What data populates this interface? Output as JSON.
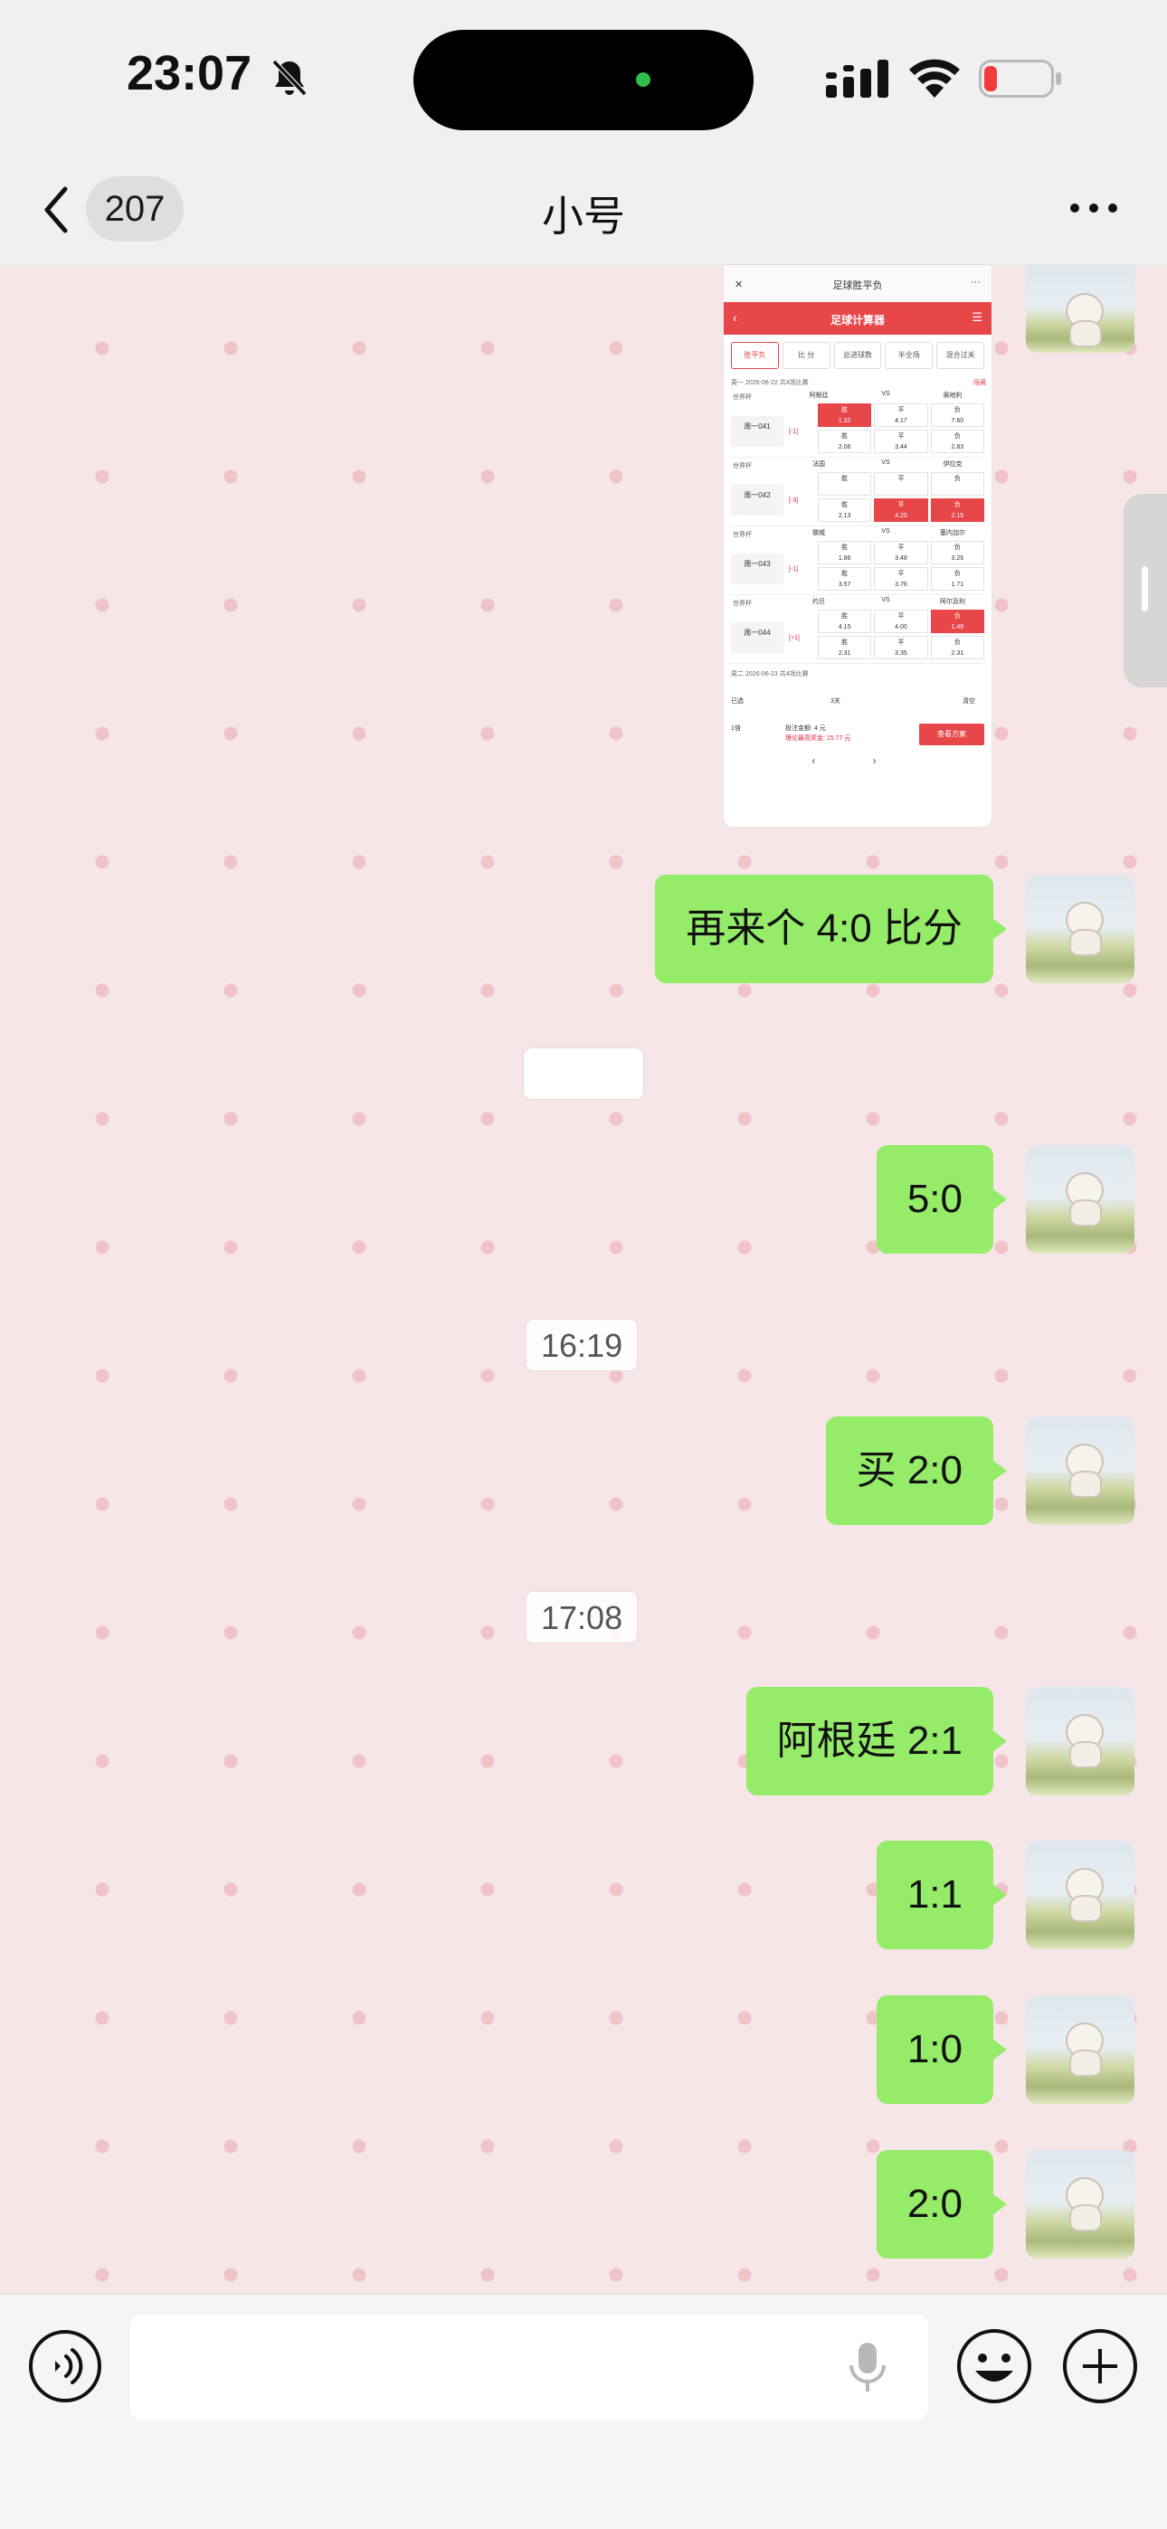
{
  "status": {
    "time": "23:07",
    "icons": [
      "bell-off-icon",
      "signal-icon",
      "wifi-icon",
      "battery-low-icon"
    ],
    "battery_color": "#f23b3b"
  },
  "nav": {
    "back_icon": "chevron-left-icon",
    "unread_count": "207",
    "title": "小号",
    "more_icon": "more-icon"
  },
  "chat": {
    "background": "#f7e6e8",
    "bubble_color": "#95ec69",
    "image_message": {
      "top_title": "足球胜平负",
      "header_title": "足球计算器",
      "tabs": [
        "胜平负",
        "比 分",
        "总进球数",
        "半全场",
        "混合过关"
      ],
      "date_line_1": "周一 2026-06-22 共4场比赛",
      "hide_label": "隐藏",
      "matches": [
        {
          "league": "世界杯",
          "no": "周一041",
          "home": "阿根廷",
          "vs": "VS",
          "away": "奥地利",
          "odds": [
            [
              "胜",
              "1.32"
            ],
            [
              "平",
              "4.17"
            ],
            [
              "负",
              "7.60"
            ],
            [
              "胜",
              "2.06"
            ],
            [
              "平",
              "3.44"
            ],
            [
              "负",
              "2.83"
            ]
          ],
          "on": [
            0
          ],
          "handicap": "[-1]"
        },
        {
          "league": "世界杯",
          "no": "周一042",
          "home": "法国",
          "vs": "VS",
          "away": "伊拉克",
          "odds": [
            [
              "胜",
              ""
            ],
            [
              "平",
              ""
            ],
            [
              "负",
              ""
            ],
            [
              "胜",
              "2.13"
            ],
            [
              "平",
              "4.25"
            ],
            [
              "负",
              "2.15"
            ]
          ],
          "on": [
            4,
            5
          ],
          "handicap": "[-3]"
        },
        {
          "league": "世界杯",
          "no": "周一043",
          "home": "挪威",
          "vs": "VS",
          "away": "塞内加尔",
          "odds": [
            [
              "胜",
              "1.86"
            ],
            [
              "平",
              "3.48"
            ],
            [
              "负",
              "3.26"
            ],
            [
              "胜",
              "3.57"
            ],
            [
              "平",
              "3.76"
            ],
            [
              "负",
              "1.71"
            ]
          ],
          "on": [],
          "handicap": "[-1]"
        },
        {
          "league": "世界杯",
          "no": "周一044",
          "home": "约旦",
          "vs": "VS",
          "away": "阿尔及利",
          "odds": [
            [
              "胜",
              "4.15"
            ],
            [
              "平",
              "4.00"
            ],
            [
              "负",
              "1.49"
            ],
            [
              "胜",
              "2.31"
            ],
            [
              "平",
              "3.35"
            ],
            [
              "负",
              "2.31"
            ]
          ],
          "on": [
            2
          ],
          "handicap": "[+1]"
        }
      ],
      "date_line_2": "周二 2026-06-23 共4场比赛",
      "selected_label": "已选",
      "pass_label": "3关",
      "clear_label": "清空",
      "multiple_label": "1倍",
      "bet_text": "投注金额: 4 元",
      "prize_text": "理论最高奖金: 15.77 元",
      "view_plan_label": "查看方案",
      "pager": "‹ ›"
    },
    "messages": [
      {
        "text": "再来个 4:0 比分"
      },
      {
        "text": "5:0"
      },
      {
        "time": "16:19"
      },
      {
        "text": "买 2:0"
      },
      {
        "time": "17:08"
      },
      {
        "text": "阿根廷 2:1"
      },
      {
        "text": "1:1"
      },
      {
        "text": "1:0"
      },
      {
        "text": "2:0"
      }
    ]
  },
  "input": {
    "value": "",
    "placeholder": "",
    "icons": [
      "voice-icon",
      "mic-icon",
      "emoji-icon",
      "plus-icon"
    ]
  }
}
